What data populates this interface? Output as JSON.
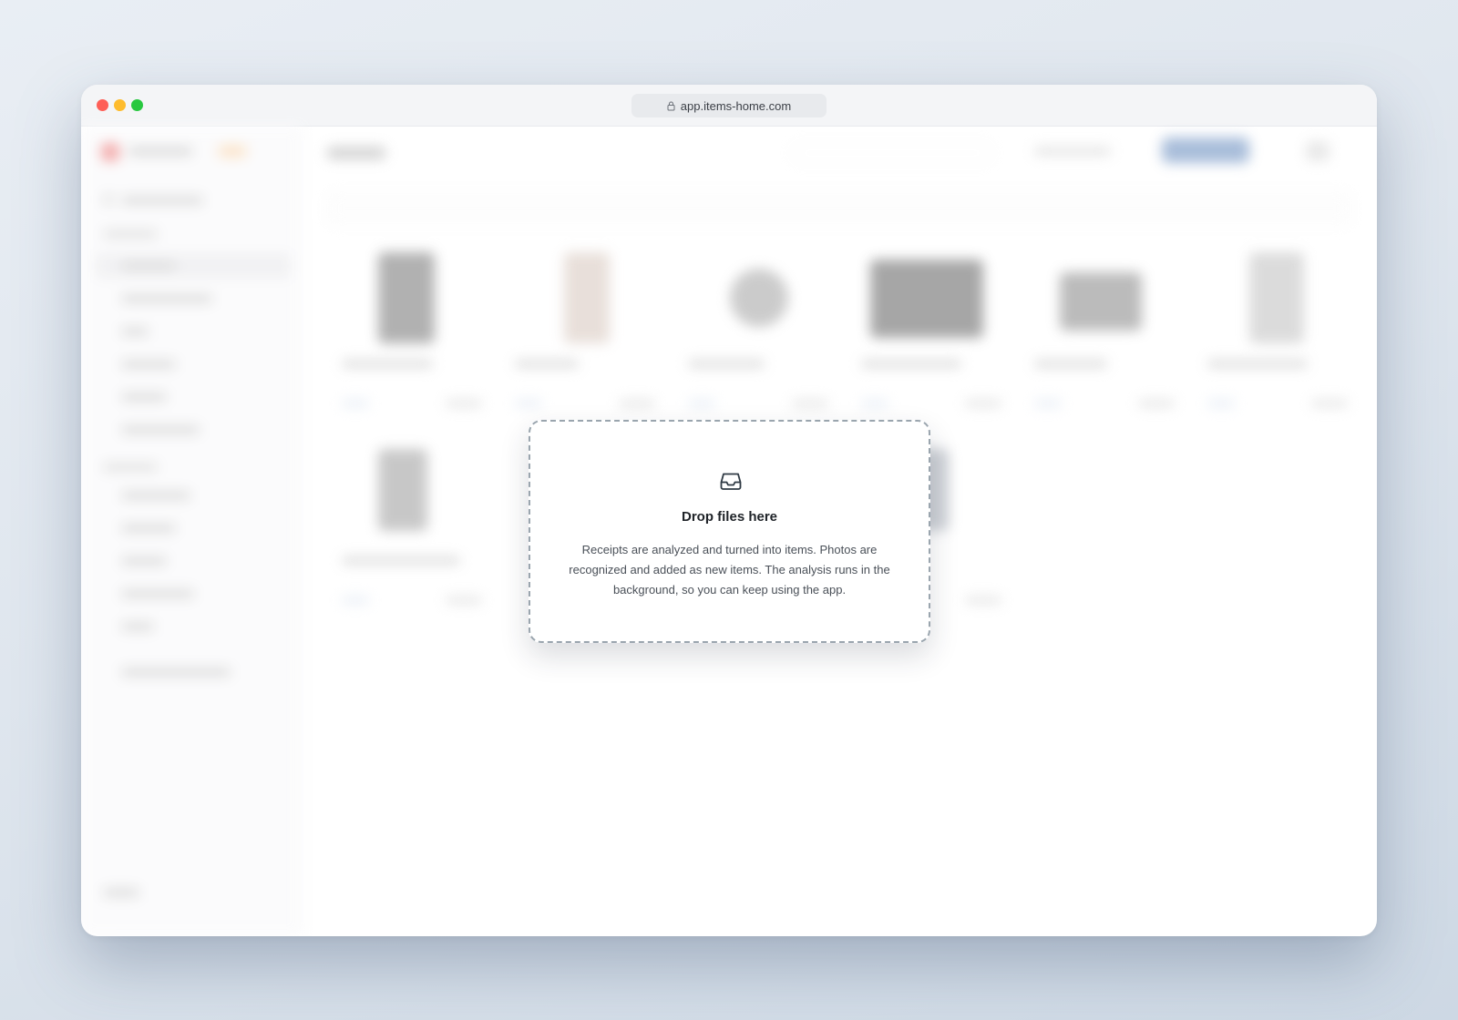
{
  "browser": {
    "url": "app.items-home.com",
    "lock_icon": "lock-icon"
  },
  "dropzone": {
    "icon": "inbox-icon",
    "title": "Drop files here",
    "description": "Receipts are analyzed and turned into items. Photos are recognized and added as new items. The analysis runs in the background, so you can keep using the app."
  },
  "colors": {
    "traffic_red": "#fe5f57",
    "traffic_yellow": "#febc2e",
    "traffic_green": "#28c840",
    "dropzone_border": "#9aa5ae"
  }
}
